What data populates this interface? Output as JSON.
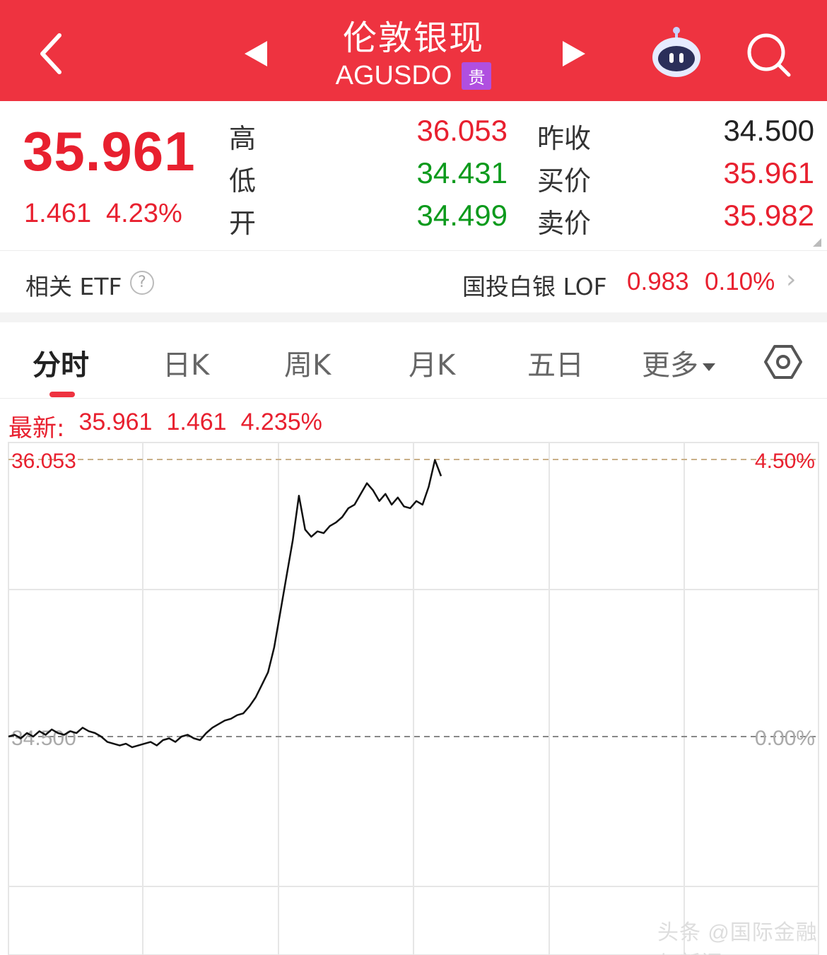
{
  "header": {
    "title": "伦敦银现",
    "code": "AGUSDO",
    "badge": "贵",
    "bg_color": "#ee3340"
  },
  "quote": {
    "price": "35.961",
    "change": "1.461",
    "change_pct": "4.23%",
    "rows": [
      {
        "label": "高",
        "value": "36.053",
        "label2": "昨收",
        "value2": "34.500"
      },
      {
        "label": "低",
        "value": "34.431",
        "label2": "买价",
        "value2": "35.961"
      },
      {
        "label": "开",
        "value": "34.499",
        "label2": "卖价",
        "value2": "35.982"
      }
    ]
  },
  "etf": {
    "label": "相关 ETF",
    "help": "?",
    "name": "国投白银 LOF",
    "price": "0.983",
    "pct": "0.10%",
    "arrow": "›"
  },
  "tabs": [
    {
      "label": "分时",
      "active": true
    },
    {
      "label": "日K",
      "active": false
    },
    {
      "label": "周K",
      "active": false
    },
    {
      "label": "月K",
      "active": false
    },
    {
      "label": "五日",
      "active": false
    },
    {
      "label": "更多",
      "active": false
    }
  ],
  "latest": {
    "label": "最新:",
    "price": "35.961",
    "change": "1.461",
    "pct": "4.235%"
  },
  "chart_data": {
    "type": "line",
    "title": "",
    "xlabel": "",
    "ylabel": "",
    "ylim": [
      34.431,
      36.053
    ],
    "reference_lines": [
      {
        "value": 36.053,
        "label": "36.053",
        "right_label": "4.50%"
      },
      {
        "value": 34.5,
        "label": "34.500",
        "right_label": "0.00%"
      }
    ],
    "grid": true,
    "series": [
      {
        "values": [
          34.5,
          34.51,
          34.49,
          34.52,
          34.5,
          34.53,
          34.51,
          34.54,
          34.52,
          34.51,
          34.53,
          34.52,
          34.55,
          34.53,
          34.52,
          34.5,
          34.47,
          34.46,
          34.45,
          34.46,
          34.44,
          34.45,
          34.46,
          34.47,
          34.45,
          34.48,
          34.49,
          34.47,
          34.5,
          34.51,
          34.49,
          34.48,
          34.52,
          34.55,
          34.57,
          34.59,
          34.6,
          34.62,
          34.63,
          34.67,
          34.72,
          34.79,
          34.86,
          35.0,
          35.2,
          35.4,
          35.6,
          35.85,
          35.66,
          35.62,
          35.65,
          35.64,
          35.68,
          35.7,
          35.73,
          35.78,
          35.8,
          35.86,
          35.92,
          35.88,
          35.82,
          35.86,
          35.8,
          35.84,
          35.79,
          35.78,
          35.82,
          35.8,
          35.9,
          36.05,
          35.96
        ]
      }
    ]
  },
  "watermark": "头条 @国际金融与新闻"
}
